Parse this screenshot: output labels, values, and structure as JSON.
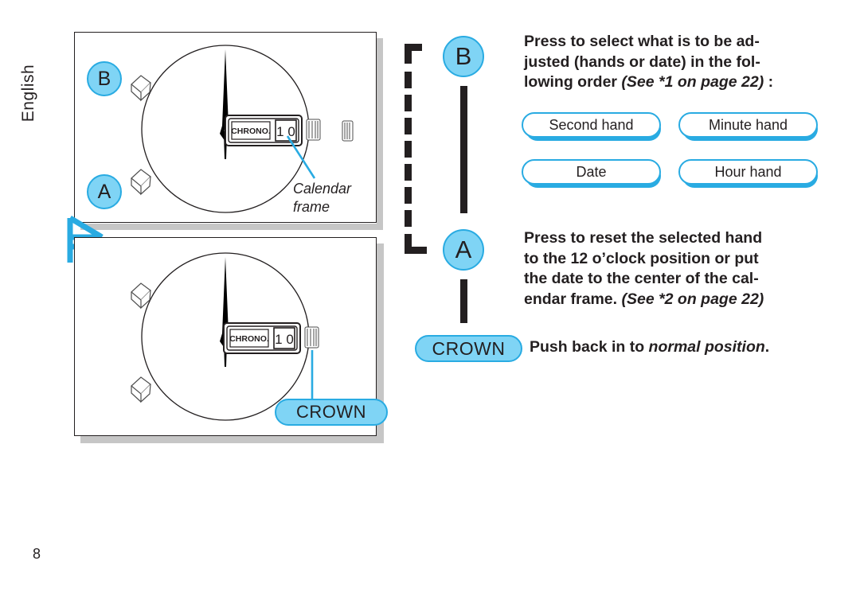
{
  "page": {
    "language_tab": "English",
    "page_number": "8"
  },
  "illustration": {
    "panel_top": {
      "marker_label": "B",
      "chrono_label": "CHRONO.",
      "date_digits": "1 0",
      "callout": "Calendar\nframe",
      "callout_line1": "Calendar",
      "callout_line2": "frame",
      "marker_a_label": "A"
    },
    "panel_bottom": {
      "chrono_label": "CHRONO.",
      "date_digits": "1 0",
      "crown_callout": "CROWN"
    },
    "transition_glyph": "chair-glyph"
  },
  "instructions": {
    "step_b": {
      "marker": "B",
      "text_line1": "Press to select what is to be ad-",
      "text_line2": "justed (hands or date) in the fol-",
      "text_line3_plain": "lowing order ",
      "text_line3_italic": "(See *1 on page 22)",
      "text_line3_tail": " :",
      "options": [
        {
          "label": "Second hand"
        },
        {
          "label": "Minute hand"
        },
        {
          "label": "Date"
        },
        {
          "label": "Hour hand"
        }
      ]
    },
    "step_a": {
      "marker": "A",
      "text_line1": "Press to reset the selected hand",
      "text_line2": "to the 12 o’clock position or put",
      "text_line3": "the date to the center of the cal-",
      "text_line4_plain": "endar frame. ",
      "text_line4_italic": "(See *2 on page 22)"
    },
    "step_crown": {
      "pill_label": "CROWN",
      "text_plain": "Push back in to ",
      "text_italic": "normal position",
      "text_tail": "."
    }
  },
  "colors": {
    "accent_blue": "#29abe2",
    "light_blue_fill": "#7fd4f5",
    "ink": "#231f20",
    "panel_shadow": "#c6c6c6"
  }
}
